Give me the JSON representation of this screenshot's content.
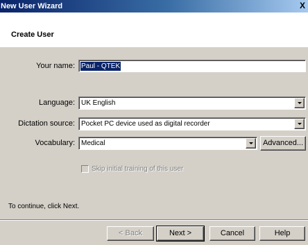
{
  "window": {
    "title": "New User Wizard",
    "close_glyph": "X"
  },
  "header": {
    "title": "Create User"
  },
  "form": {
    "name_label": "Your name:",
    "name_value": "Paul - QTEK",
    "language_label": "Language:",
    "language_value": "UK English",
    "dictation_label": "Dictation source:",
    "dictation_value": "Pocket PC device used as digital recorder",
    "vocabulary_label": "Vocabulary:",
    "vocabulary_value": "Medical",
    "advanced_label": "Advanced...",
    "skip_training_label": "Skip initial training of this user",
    "skip_training_checked": false
  },
  "footer": {
    "instruction": "To continue, click Next.",
    "back_label": "< Back",
    "next_label": "Next >",
    "cancel_label": "Cancel",
    "help_label": "Help"
  },
  "icons": {
    "dropdown": "dropdown-arrow-icon",
    "close": "close-icon",
    "checkbox": "checkbox-icon"
  }
}
